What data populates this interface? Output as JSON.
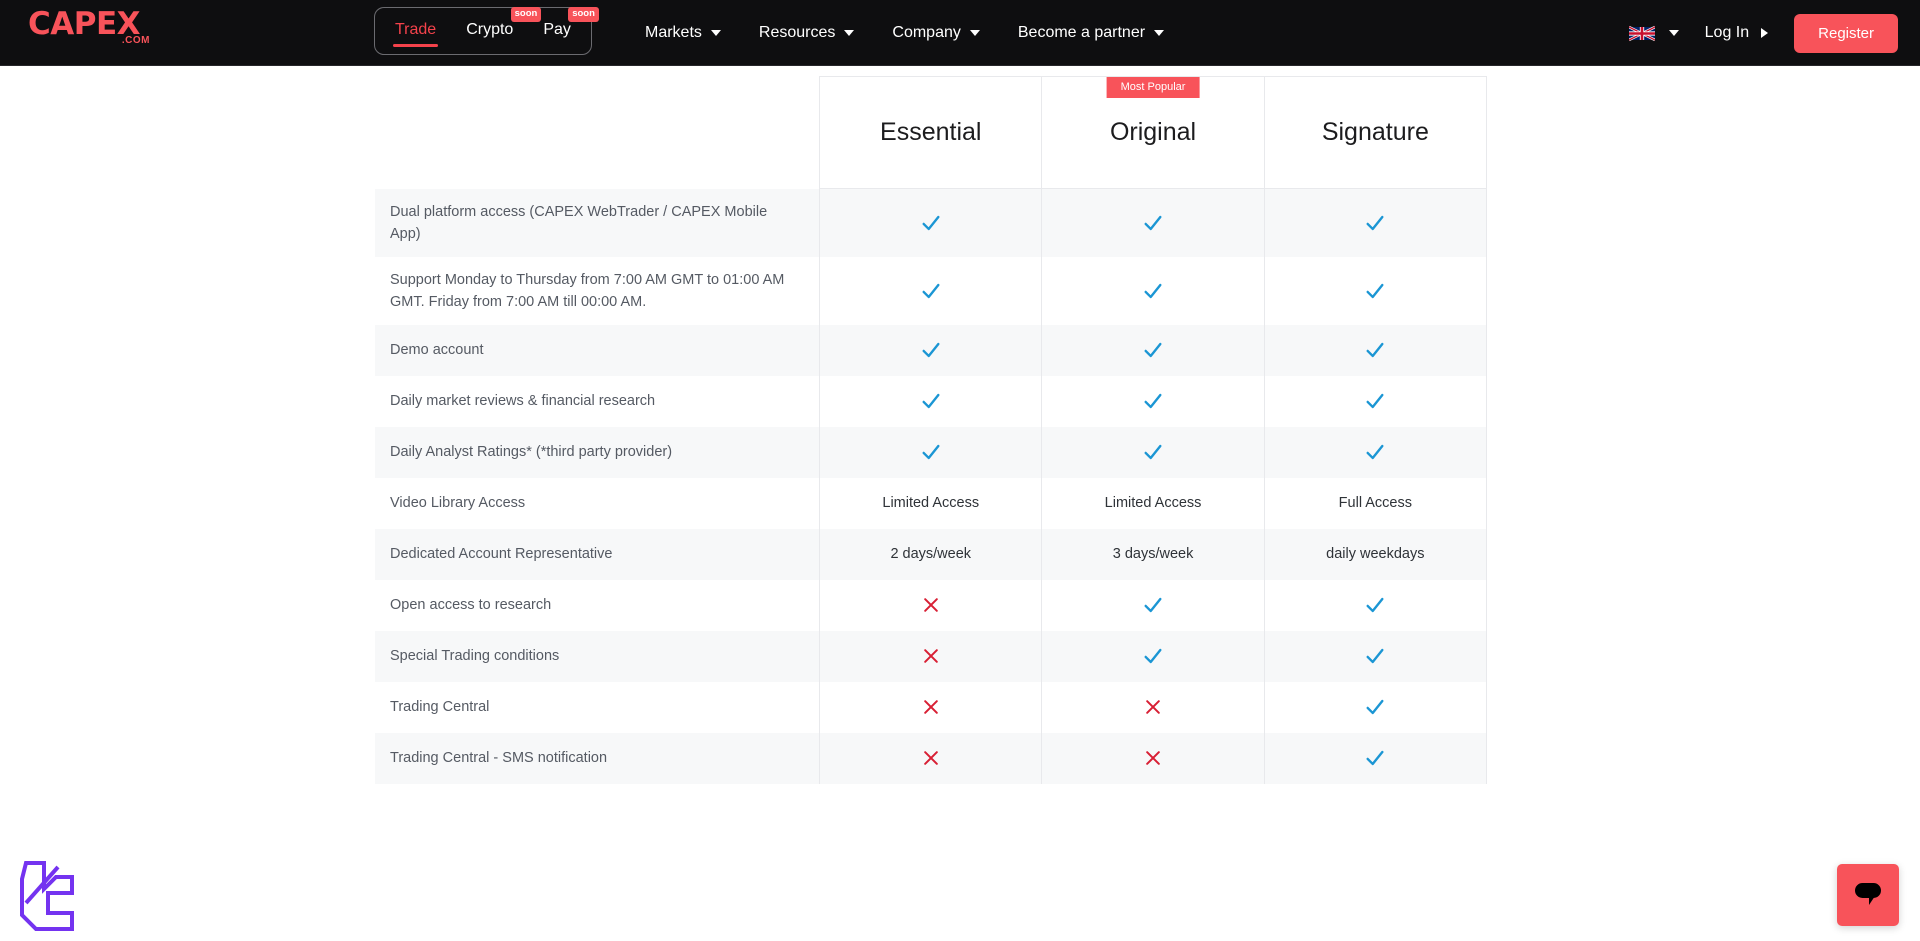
{
  "header": {
    "brand": {
      "name": "CAPEX",
      "suffix": ".COM",
      "color": "#f8535a"
    },
    "segments": [
      {
        "label": "Trade",
        "active": true,
        "badge": ""
      },
      {
        "label": "Crypto",
        "active": false,
        "badge": "soon"
      },
      {
        "label": "Pay",
        "active": false,
        "badge": "soon"
      }
    ],
    "nav": [
      {
        "label": "Markets",
        "icon": "chevron-down-icon"
      },
      {
        "label": "Resources",
        "icon": "chevron-down-icon"
      },
      {
        "label": "Company",
        "icon": "chevron-down-icon"
      },
      {
        "label": "Become a partner",
        "icon": "chevron-down-icon"
      }
    ],
    "language": {
      "icon": "uk-flag-icon",
      "chevron": "chevron-down-icon"
    },
    "login_label": "Log In",
    "login_arrow": "triangle-right-icon",
    "register_label": "Register"
  },
  "comparison_table": {
    "plans": [
      {
        "name": "Essential",
        "badge": ""
      },
      {
        "name": "Original",
        "badge": "Most Popular"
      },
      {
        "name": "Signature",
        "badge": ""
      }
    ],
    "rows": [
      {
        "feature": "Dual platform access (CAPEX WebTrader / CAPEX Mobile App)",
        "values": [
          "check",
          "check",
          "check"
        ]
      },
      {
        "feature": "Support Monday to Thursday from 7:00 AM GMT to 01:00 AM GMT. Friday from 7:00 AM till 00:00 AM.",
        "values": [
          "check",
          "check",
          "check"
        ]
      },
      {
        "feature": "Demo account",
        "values": [
          "check",
          "check",
          "check"
        ]
      },
      {
        "feature": "Daily market reviews & financial research",
        "values": [
          "check",
          "check",
          "check"
        ]
      },
      {
        "feature": "Daily Analyst Ratings* (*third party provider)",
        "values": [
          "check",
          "check",
          "check"
        ]
      },
      {
        "feature": "Video Library Access",
        "values": [
          "Limited Access",
          "Limited Access",
          "Full Access"
        ]
      },
      {
        "feature": "Dedicated Account Representative",
        "values": [
          "2 days/week",
          "3 days/week",
          "daily weekdays"
        ]
      },
      {
        "feature": "Open access to research",
        "values": [
          "cross",
          "check",
          "check"
        ]
      },
      {
        "feature": "Special Trading conditions",
        "values": [
          "cross",
          "check",
          "check"
        ]
      },
      {
        "feature": "Trading Central",
        "values": [
          "cross",
          "cross",
          "check"
        ]
      },
      {
        "feature": "Trading Central - SMS notification",
        "values": [
          "cross",
          "cross",
          "check"
        ]
      }
    ]
  },
  "widgets": {
    "brand_watermark": "lc-monogram-logo",
    "chat_button": "chat-bubble-icon"
  },
  "colors": {
    "accent_red": "#f8535a",
    "check_blue": "#1b96d4",
    "cross_red": "#d81f34",
    "header_bg": "#0e0e10",
    "stripe": "#f7f8f9",
    "border": "#e8e9ec",
    "watermark_purple": "#7433f0"
  }
}
